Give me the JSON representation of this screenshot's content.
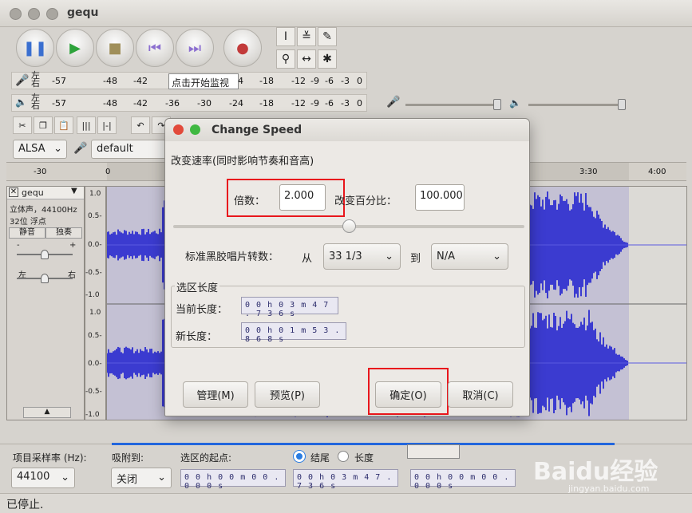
{
  "window": {
    "title": "gequ"
  },
  "meters": {
    "rec_lr": "左\n右",
    "play_lr": "左\n右",
    "rec_ticks": [
      "-57",
      "-48",
      "-42",
      "-18",
      "-12",
      "-9",
      "-6",
      "-3",
      "0"
    ],
    "rec_tick_4": "4",
    "play_ticks": [
      "-57",
      "-48",
      "-42",
      "-36",
      "-30",
      "-24",
      "-18",
      "-12",
      "-9",
      "-6",
      "-3",
      "0"
    ],
    "monitor_tooltip": "点击开始监视"
  },
  "device": {
    "host": "ALSA",
    "input": "default"
  },
  "timeline": {
    "labels": [
      "-30",
      "0",
      "3:30",
      "4:00"
    ]
  },
  "track": {
    "name": "gequ",
    "info1": "立体声，44100Hz",
    "info2": "32位 浮点",
    "mute": "静音",
    "solo": "独奏",
    "pan_left": "左",
    "pan_right": "右",
    "gain_minus": "-",
    "gain_plus": "+",
    "yticks_top": [
      "1.0",
      "0.5-",
      "0.0-",
      "-0.5-",
      "-1.0"
    ],
    "yticks_bottom": [
      "1.0",
      "0.5-",
      "0.0-",
      "-0.5-",
      "-1.0"
    ]
  },
  "dialog": {
    "title": "Change Speed",
    "desc": "改变速率(同时影响节奏和音高)",
    "multiplier_label": "倍数：",
    "multiplier_value": "2.000",
    "percent_label": "改变百分比：",
    "percent_value": "100.000",
    "vinyl_label": "标准黑胶唱片转数：",
    "from_label": "从",
    "from_value": "33 1/3",
    "to_label": "到",
    "to_value": "N/A",
    "selection_group": "选区长度",
    "current_label": "当前长度：",
    "current_value": "0 0 h 0 3 m 4 7 . 7 3 6 s",
    "new_label": "新长度：",
    "new_value": "0 0 h 0 1 m 5 3 . 8 6 8 s",
    "manage_btn": "管理(M)",
    "preview_btn": "预览(P)",
    "ok_btn": "确定(O)",
    "cancel_btn": "取消(C)",
    "slider_fraction": 0.5
  },
  "bottom": {
    "rate_label": "项目采样率 (Hz):",
    "rate_value": "44100",
    "snap_label": "吸附到:",
    "snap_value": "关闭",
    "sel_start_label": "选区的起点:",
    "end_label": "结尾",
    "length_label": "长度",
    "sel_start_value": "0 0 h 0 0 m 0 0 . 0 0 0 s",
    "sel_end_value": "0 0 h 0 3 m 4 7 . 7 3 6 s",
    "audio_pos_value": "0 0 h 0 0 m 0 0 . 0 0 0 s"
  },
  "status": {
    "text": "已停止."
  },
  "watermark": {
    "text": "Baidu经验",
    "sub": "jingyan.baidu.com"
  },
  "colors": {
    "wave": "#3b3bd0",
    "highlight": "#e8161c",
    "accent": "#2266dd"
  }
}
